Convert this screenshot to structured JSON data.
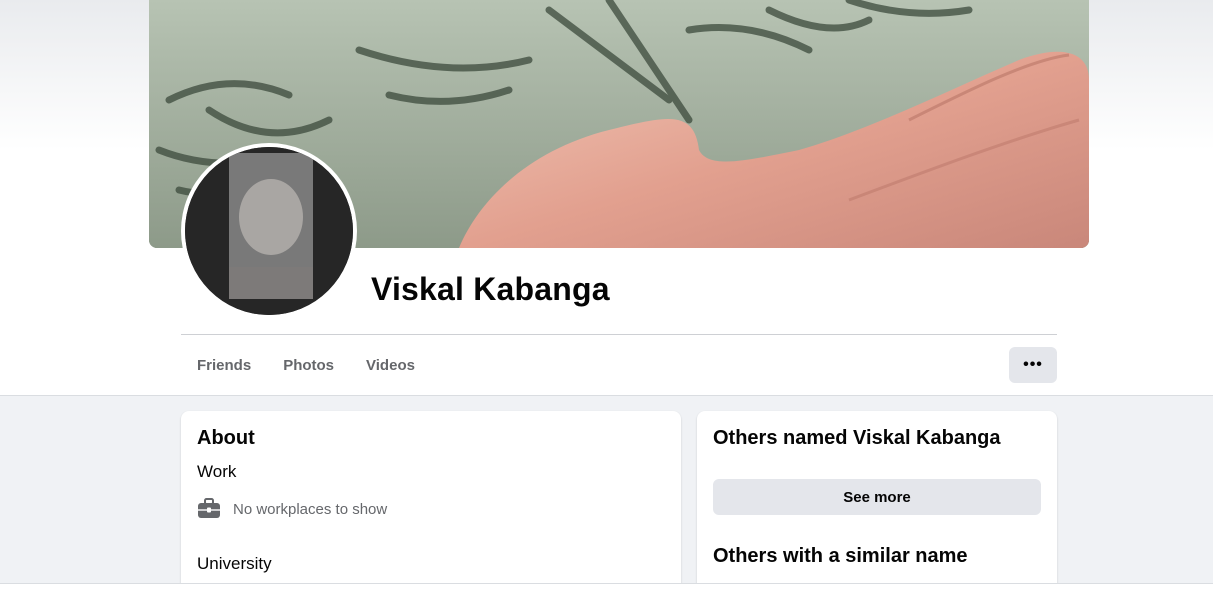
{
  "profile": {
    "name": "Viskal Kabanga"
  },
  "tabs": [
    {
      "label": "Friends"
    },
    {
      "label": "Photos"
    },
    {
      "label": "Videos"
    }
  ],
  "more_button": {
    "label": "•••",
    "icon": "more-icon"
  },
  "about": {
    "title": "About",
    "work_label": "Work",
    "no_work_text": "No workplaces to show",
    "work_icon": "briefcase-icon",
    "university_label": "University"
  },
  "others": {
    "title": "Others named Viskal Kabanga",
    "see_more_label": "See more",
    "similar_title": "Others with a similar name"
  },
  "colors": {
    "background": "#f0f2f5",
    "text_primary": "#050505",
    "text_secondary": "#65676b",
    "button_bg": "#e4e6eb"
  }
}
